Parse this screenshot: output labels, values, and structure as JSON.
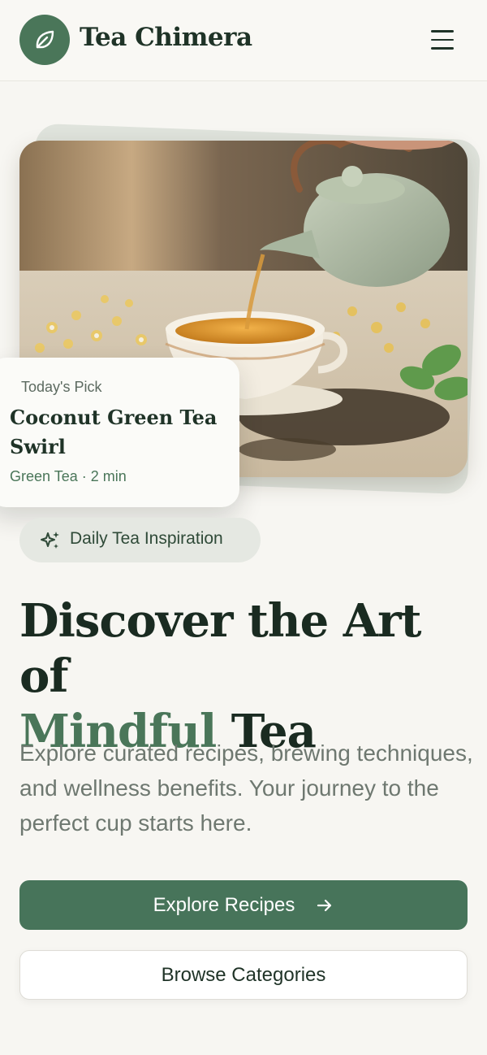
{
  "header": {
    "brand": "Tea Chimera",
    "logo_icon": "leaf-icon",
    "menu_icon": "hamburger-menu-icon"
  },
  "hero": {
    "image_subject": "teapot pouring tea into cup with dried chamomile and mint",
    "pick": {
      "label": "Today's Pick",
      "title": "Coconut Green Tea Swirl",
      "meta": "Green Tea · 2 min"
    }
  },
  "badge": {
    "icon": "sparkles-icon",
    "label": "Daily Tea Inspiration"
  },
  "headline": {
    "line1": "Discover the Art of",
    "accent": "Mindful",
    "tail": " Tea"
  },
  "lead": "Explore curated recipes, brewing techniques, and wellness benefits. Your journey to the perfect cup starts here.",
  "actions": {
    "primary_label": "Explore Recipes",
    "primary_icon": "arrow-right-icon",
    "secondary_label": "Browse Categories"
  },
  "colors": {
    "brand_green": "#4a7659",
    "dark_text": "#1f3327",
    "background": "#f7f6f2"
  }
}
